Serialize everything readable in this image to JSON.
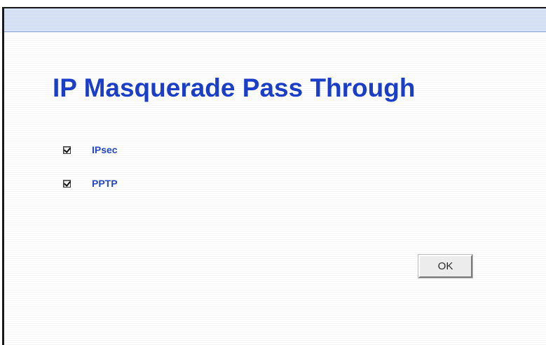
{
  "page": {
    "title": "IP Masquerade Pass Through"
  },
  "options": [
    {
      "label": "IPsec",
      "checked": true
    },
    {
      "label": "PPTP",
      "checked": true
    }
  ],
  "actions": {
    "ok_label": "OK"
  },
  "colors": {
    "title": "#1a3ec8",
    "label": "#2446c8",
    "band": "#c9d6ef"
  }
}
